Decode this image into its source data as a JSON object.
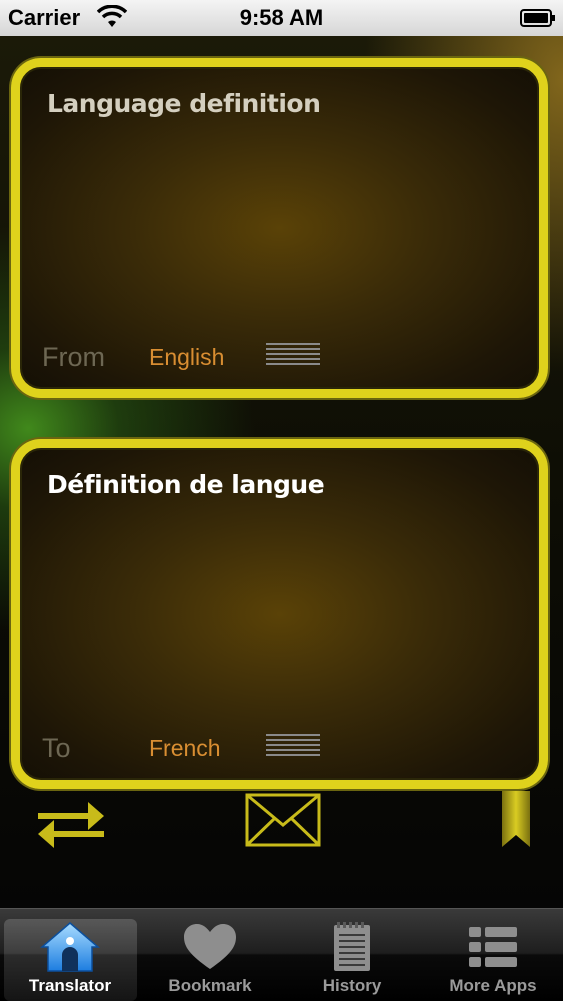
{
  "status_bar": {
    "carrier": "Carrier",
    "time": "9:58 AM"
  },
  "source": {
    "text": "Language definition",
    "direction_label": "From",
    "language": "English"
  },
  "target": {
    "text": "Définition de langue",
    "direction_label": "To",
    "language": "French"
  },
  "toolbar": {
    "icons": [
      "swap-icon",
      "mail-icon",
      "bookmark-icon"
    ]
  },
  "tab_bar": {
    "active": "Translator",
    "tabs": [
      {
        "label": "Translator",
        "icon": "house-icon"
      },
      {
        "label": "Bookmark",
        "icon": "heart-icon"
      },
      {
        "label": "History",
        "icon": "notepad-icon"
      },
      {
        "label": "More Apps",
        "icon": "list-icon"
      }
    ]
  },
  "colors": {
    "card_border": "#dfd21c",
    "language_label": "#d98e32",
    "accent_icons": "#c8bb1a"
  }
}
